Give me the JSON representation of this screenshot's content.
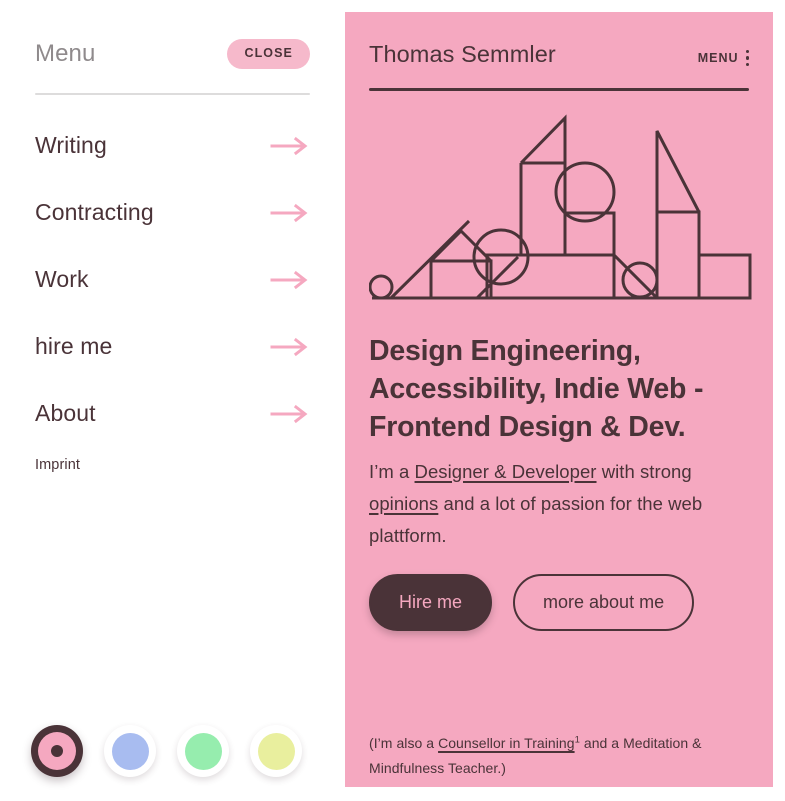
{
  "theme": {
    "accent_pink": "#f5a8c0",
    "pill_pink": "#f6b9cb",
    "ink_dark": "#4a3338",
    "muted_gray": "#8f8a8c",
    "divider_gray": "#dddcdc"
  },
  "sidebar": {
    "title": "Menu",
    "close_label": "CLOSE",
    "items": [
      {
        "label": "Writing",
        "arrow_icon": "arrow-right-icon"
      },
      {
        "label": "Contracting",
        "arrow_icon": "arrow-right-icon"
      },
      {
        "label": "Work",
        "arrow_icon": "arrow-right-icon"
      },
      {
        "label": "hire me",
        "arrow_icon": "arrow-right-icon"
      },
      {
        "label": "About",
        "arrow_icon": "arrow-right-icon"
      }
    ],
    "imprint_label": "Imprint",
    "swatches": [
      {
        "name": "pink-theme",
        "color": "#f5a8c0",
        "selected": true
      },
      {
        "name": "blue-theme",
        "color": "#a8bcf0",
        "selected": false
      },
      {
        "name": "green-theme",
        "color": "#96edae",
        "selected": false
      },
      {
        "name": "yellow-theme",
        "color": "#e9ef9e",
        "selected": false
      }
    ]
  },
  "hero": {
    "name": "Thomas Semmler",
    "menu_label": "MENU",
    "menu_icon": "kebab-menu-icon",
    "illustration_icon": "geometric-skyline-illustration",
    "heading": "Design Engineering, Accessibility, Indie Web - Frontend Design & Dev.",
    "paragraph": {
      "lead": "I’m a ",
      "link1": "Designer & Developer",
      "mid": " with strong ",
      "link2": "opinions",
      "tail": " and a lot of passion for the web plattform."
    },
    "primary_button": "Hire me",
    "secondary_button": "more about me",
    "footnote": {
      "lead": "(I’m also a ",
      "link": "Counsellor in Training",
      "sup": "1",
      "tail": " and a Meditation & Mindfulness Teacher.)"
    }
  }
}
